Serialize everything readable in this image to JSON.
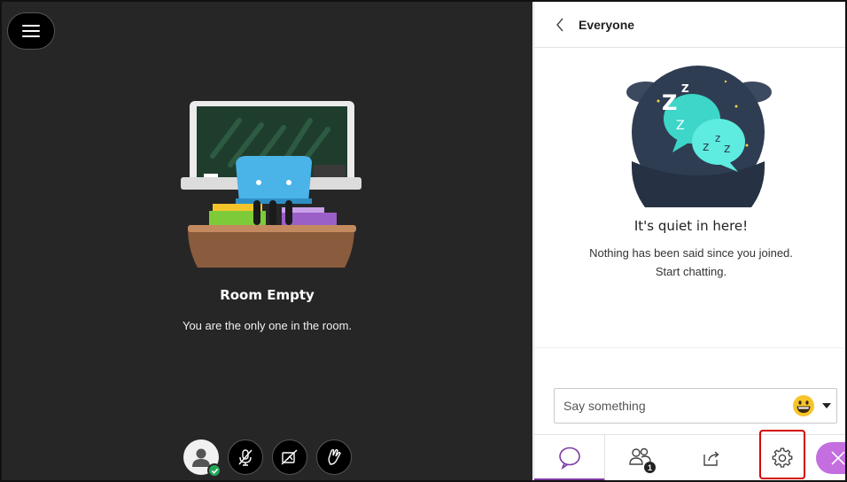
{
  "stage": {
    "menu_icon": "hamburger-icon",
    "room_title": "Room Empty",
    "room_subtitle": "You are the only one in the room.",
    "controls": [
      {
        "name": "avatar",
        "icon": "user-avatar-icon",
        "status": "connected-check-icon"
      },
      {
        "name": "microphone",
        "icon": "mic-off-icon"
      },
      {
        "name": "camera",
        "icon": "camera-off-icon"
      },
      {
        "name": "raise-hand",
        "icon": "hand-icon"
      }
    ]
  },
  "chat": {
    "header": {
      "back_icon": "chevron-left-icon",
      "title": "Everyone"
    },
    "empty_state": {
      "title": "It's quiet in here!",
      "line1": "Nothing has been said since you joined.",
      "line2": "Start chatting."
    },
    "composer": {
      "placeholder": "Say something",
      "emoji_icon": "grinning-emoji-icon",
      "caret_icon": "caret-down-icon"
    },
    "tabs": [
      {
        "name": "chat",
        "icon": "chat-bubble-icon",
        "active": true
      },
      {
        "name": "attendees",
        "icon": "attendees-icon",
        "badge": "1"
      },
      {
        "name": "share-content",
        "icon": "share-icon"
      },
      {
        "name": "settings",
        "icon": "gear-icon",
        "highlighted": true
      }
    ],
    "close_icon": "close-icon"
  },
  "colors": {
    "stage_bg": "#262626",
    "accent_purple": "#7c3aa5",
    "close_button": "#c46ee0",
    "highlight_red": "#d40000",
    "status_green": "#23a85a",
    "teal": "#3dd6c8"
  }
}
